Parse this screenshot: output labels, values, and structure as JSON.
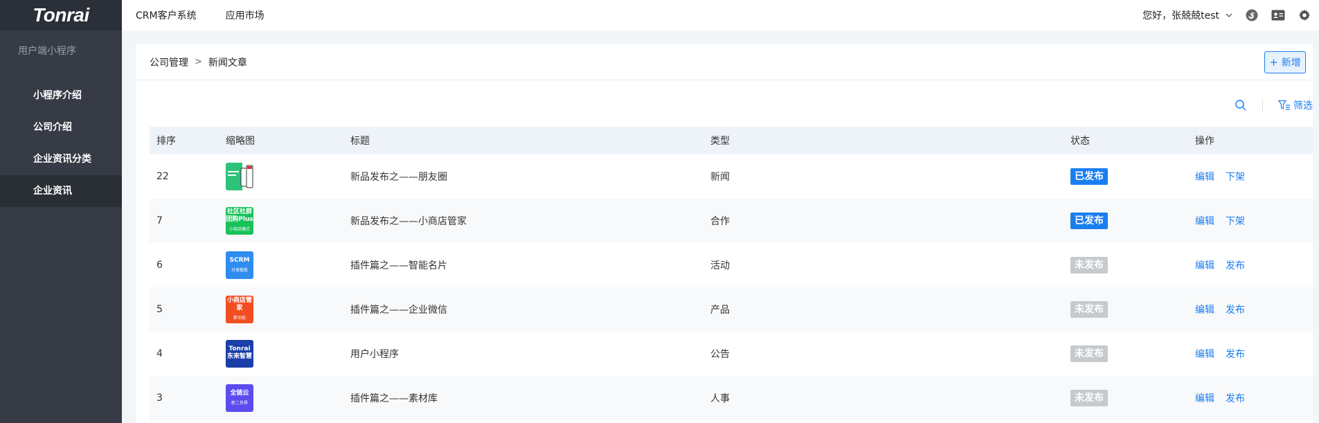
{
  "brand": {
    "logo_text": "Tonrai"
  },
  "sidebar": {
    "section": "用户端小程序",
    "items": [
      {
        "label": "小程序介绍",
        "active": false
      },
      {
        "label": "公司介绍",
        "active": false
      },
      {
        "label": "企业资讯分类",
        "active": false
      },
      {
        "label": "企业资讯",
        "active": true
      }
    ]
  },
  "topnav": {
    "links": [
      "CRM客户系统",
      "应用市场"
    ],
    "greeting": "您好，张兢兢test",
    "icons": [
      "chevron-down-icon",
      "mini-program-icon",
      "contact-card-icon",
      "gear-icon"
    ]
  },
  "page": {
    "breadcrumb": [
      "公司管理",
      "新闻文章"
    ],
    "breadcrumb_sep": ">",
    "add_button": {
      "icon": "+",
      "label": "新增"
    },
    "filter_label": "筛选"
  },
  "table": {
    "headers": [
      "排序",
      "缩略图",
      "标题",
      "类型",
      "状态",
      "操作"
    ],
    "rows": [
      {
        "sort": "22",
        "thumb": {
          "line1": "",
          "line2": "",
          "sub": "",
          "bg": "#2ec27a",
          "style": "phone"
        },
        "title": "新品发布之——朋友圈",
        "type": "新闻",
        "status": "已发布",
        "published": true,
        "ops": [
          "编辑",
          "下架"
        ]
      },
      {
        "sort": "7",
        "thumb": {
          "line1": "社区社群",
          "line2": "团购Plus",
          "sub": "小商店模式",
          "bg": "#18c25a",
          "style": "text"
        },
        "title": "新品发布之——小商店管家",
        "type": "合作",
        "status": "已发布",
        "published": true,
        "ops": [
          "编辑",
          "下架"
        ]
      },
      {
        "sort": "6",
        "thumb": {
          "line1": "SCRM",
          "line2": "",
          "sub": "分享赋能",
          "bg": "#2f8cf0",
          "style": "text"
        },
        "title": "插件篇之——智能名片",
        "type": "活动",
        "status": "未发布",
        "published": false,
        "ops": [
          "编辑",
          "发布"
        ]
      },
      {
        "sort": "5",
        "thumb": {
          "line1": "小商店管家",
          "line2": "",
          "sub": "新功能",
          "bg": "#f24e22",
          "style": "text"
        },
        "title": "插件篇之——企业微信",
        "type": "产品",
        "status": "未发布",
        "published": false,
        "ops": [
          "编辑",
          "发布"
        ]
      },
      {
        "sort": "4",
        "thumb": {
          "line1": "Tonrai",
          "line2": "东来智慧",
          "sub": "",
          "bg": "#1b3fa8",
          "style": "text"
        },
        "title": "用户小程序",
        "type": "公告",
        "status": "未发布",
        "published": false,
        "ops": [
          "编辑",
          "发布"
        ]
      },
      {
        "sort": "3",
        "thumb": {
          "line1": "全链云",
          "line2": "",
          "sub": "新二世界",
          "bg": "#5b4cf0",
          "style": "text"
        },
        "title": "插件篇之——素材库",
        "type": "人事",
        "status": "未发布",
        "published": false,
        "ops": [
          "编辑",
          "发布"
        ]
      }
    ]
  },
  "colors": {
    "accent": "#1a7ef0",
    "sidebar_bg": "#363b45",
    "published": "#1a7ef0",
    "unpublished": "#c6c9ce"
  }
}
